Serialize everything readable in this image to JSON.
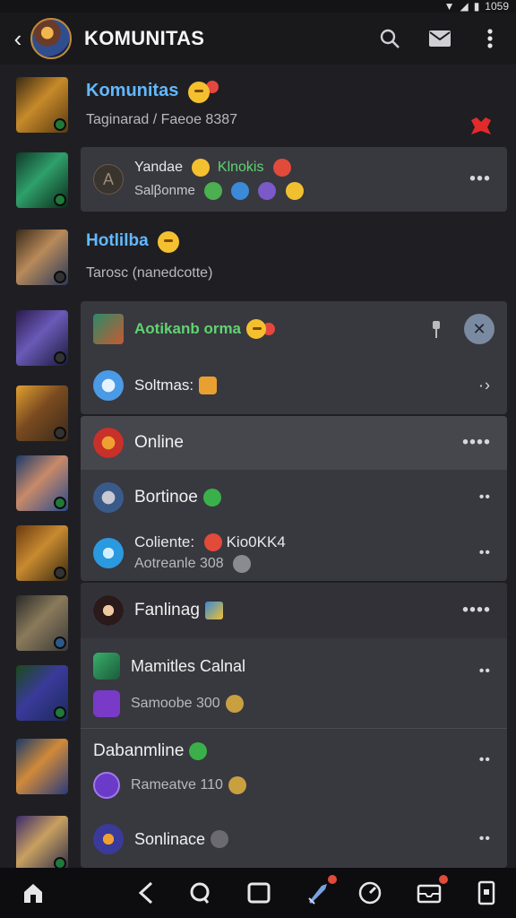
{
  "status_bar": {
    "time": "1059"
  },
  "header": {
    "title": "KOMUNITAS"
  },
  "rows": {
    "r1_name": "Komunitas",
    "r1_sub": "Taginarad / Faeoe 8387",
    "r2_name": "Yandae",
    "r2_tag": "Klnokis",
    "r2_sub": "Salβonme",
    "r2_avatar_letter": "A",
    "r3_name": "Hotlilba",
    "r3_sub": "Tarosc (nanedcotte)",
    "r4_name": "Aotikanb orma",
    "r5_name": "Soltmas:",
    "r6_name": "Online",
    "r7_name": "Bortinoe",
    "r8_name": "Coliente:",
    "r8_tag": "Kio0KK4",
    "r8_sub": "Aotreanle 308",
    "r9_name": "Fanlinag",
    "r10_name": "Mamitles Calnal",
    "r10_sub": "Samoobe 300",
    "r11_name": "Dabanmline",
    "r11_sub": "Rameatve 110",
    "r12_name": "Sonlinace"
  },
  "colors": {
    "accent_blue": "#63b8ff",
    "accent_green": "#5fd46f",
    "badge_red": "#e4473f",
    "card_bg": "#38383f"
  }
}
